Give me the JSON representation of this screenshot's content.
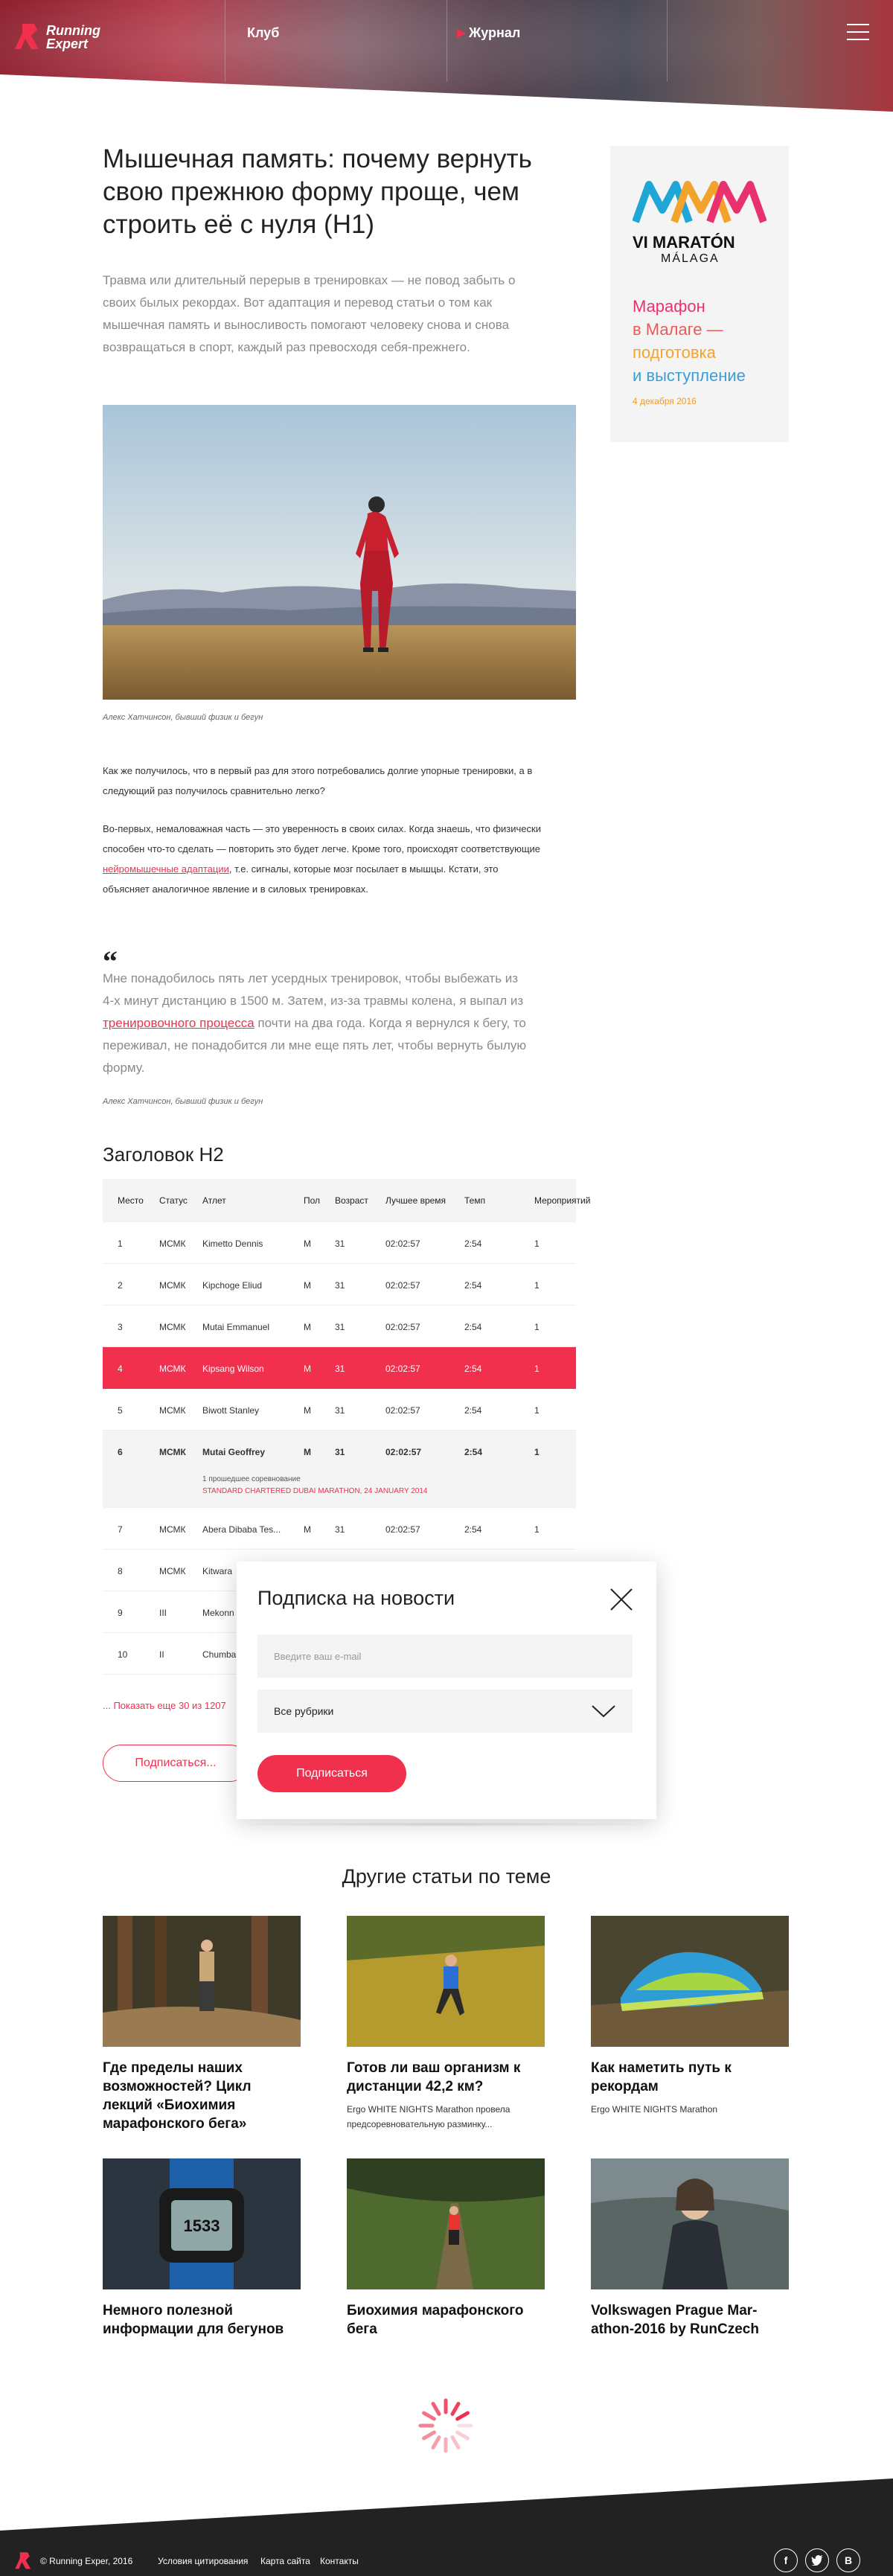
{
  "header": {
    "logo_line1": "Running",
    "logo_line2": "Expert",
    "nav": [
      {
        "label": "Клуб"
      },
      {
        "label": "Журнал"
      }
    ]
  },
  "article": {
    "title": "Мышечная память: почему вернуть свою прежнюю форму проще, чем строить её с нуля (H1)",
    "lead": "Травма или длительный перерыв в тренировках — не повод забыть о своих былых рекордах. Вот адаптация и перевод статьи о том как мышечная память и выносливость помогают человеку снова и снова возвращаться в спорт, каждый раз превосходя себя-прежнего.",
    "image_caption": "Алекс Хатчинсон, бывший физик и бегун",
    "para1": "Как же получилось, что в первый раз для этого потребовались долгие упорные тренировки, а в следующий раз получилось сравнительно легко?",
    "para2_before": "Во-первых, немаловажная часть — это уверенность в своих силах. Когда знаешь, что физически способен что-то сделать — повторить это будет легче. Кроме того, происходят соответствующие ",
    "para2_link": "нейромышечные адаптации",
    "para2_after": ", т.е. сигналы, которые мозг посылает в мышцы. Кстати, это объясняет аналогичное явление и в силовых тренировках.",
    "quote_mark": "“",
    "quote_before": "Мне понадобилось пять лет усердных тренировок, чтобы выбежать из 4-х минут дистанцию в 1500 м. Затем, из-за травмы колена, я выпал из ",
    "quote_link": "тренировочного процесса",
    "quote_after": " почти на два года. Когда я вернулся к бегу, то переживал, не понадобится ли мне еще пять лет, чтобы вернуть былую форму.",
    "quote_author": "Алекс Хатчинсон, бывший физик и бегун",
    "h2": "Заголовок H2"
  },
  "ad": {
    "brand_line1": "VI MARATÓN",
    "brand_line2": "MÁLAGA",
    "title_line1": "Марафон",
    "title_line2": "в Малаге —",
    "title_line3": "подготовка",
    "title_line4": "и выступление",
    "date": "4 декабря 2016"
  },
  "table": {
    "headers": [
      "Место",
      "Статус",
      "Атлет",
      "Пол",
      "Возраст",
      "Лучшее время",
      "Темп",
      "Мероприятий"
    ],
    "rows": [
      [
        "1",
        "МСМК",
        "Kimetto Dennis",
        "M",
        "31",
        "02:02:57",
        "2:54",
        "1"
      ],
      [
        "2",
        "МСМК",
        "Kipchoge Eliud",
        "M",
        "31",
        "02:02:57",
        "2:54",
        "1"
      ],
      [
        "3",
        "МСМК",
        "Mutai Emmanuel",
        "M",
        "31",
        "02:02:57",
        "2:54",
        "1"
      ],
      [
        "4",
        "МСМК",
        "Kipsang Wilson",
        "M",
        "31",
        "02:02:57",
        "2:54",
        "1"
      ],
      [
        "5",
        "МСМК",
        "Biwott Stanley",
        "M",
        "31",
        "02:02:57",
        "2:54",
        "1"
      ],
      [
        "6",
        "МСМК",
        "Mutai Geoffrey",
        "M",
        "31",
        "02:02:57",
        "2:54",
        "1"
      ],
      [
        "7",
        "МСМК",
        "Abera Dibaba Tes...",
        "M",
        "31",
        "02:02:57",
        "2:54",
        "1"
      ],
      [
        "8",
        "МСМК",
        "Kitwara",
        "",
        "",
        "",
        "",
        ""
      ],
      [
        "9",
        "III",
        "Mekonn",
        "",
        "",
        "",
        "",
        ""
      ],
      [
        "10",
        "II",
        "Chumba",
        "",
        "",
        "",
        "",
        ""
      ]
    ],
    "row6_sub1": "1 прошедшее соревнование",
    "row6_sub2": "STANDARD CHARTERED DUBAI MARATHON, 24 JANUARY 2014",
    "more_link": "... Показать еще 30 из 1207",
    "subscribe_outline": "Подписаться..."
  },
  "popup": {
    "title": "Подписка на новости",
    "email_placeholder": "Введите ваш e-mail",
    "select_value": "Все рубрики",
    "button": "Подписаться"
  },
  "related": {
    "title": "Другие статьи по теме",
    "cards": [
      {
        "title": "Где пределы наших возможностей? Цикл лекций «Биохимия марафонского бега»",
        "desc": ""
      },
      {
        "title": "Готов ли ваш организм к дистанции 42,2 км?",
        "desc": "Ergo WHITE NIGHTS Marathon провела предсоревновательную разминку..."
      },
      {
        "title": "Как наметить путь к рекордам",
        "desc": "Ergo WHITE NIGHTS Marathon"
      },
      {
        "title": "Немного полезной информации для бегунов",
        "desc": ""
      },
      {
        "title": "Биохимия марафонского бега",
        "desc": ""
      },
      {
        "title": "Volkswagen Prague Mar- athon-2016 by RunCzech",
        "desc": ""
      }
    ],
    "watch_time": "1533"
  },
  "footer": {
    "copyright": "© Running Exper, 2016",
    "links": [
      "Условия цитирования",
      "Карта сайта",
      "Контакты"
    ],
    "social": [
      "f",
      "t",
      "В"
    ]
  },
  "colors": {
    "accent": "#f0304d",
    "dark": "#222222"
  }
}
